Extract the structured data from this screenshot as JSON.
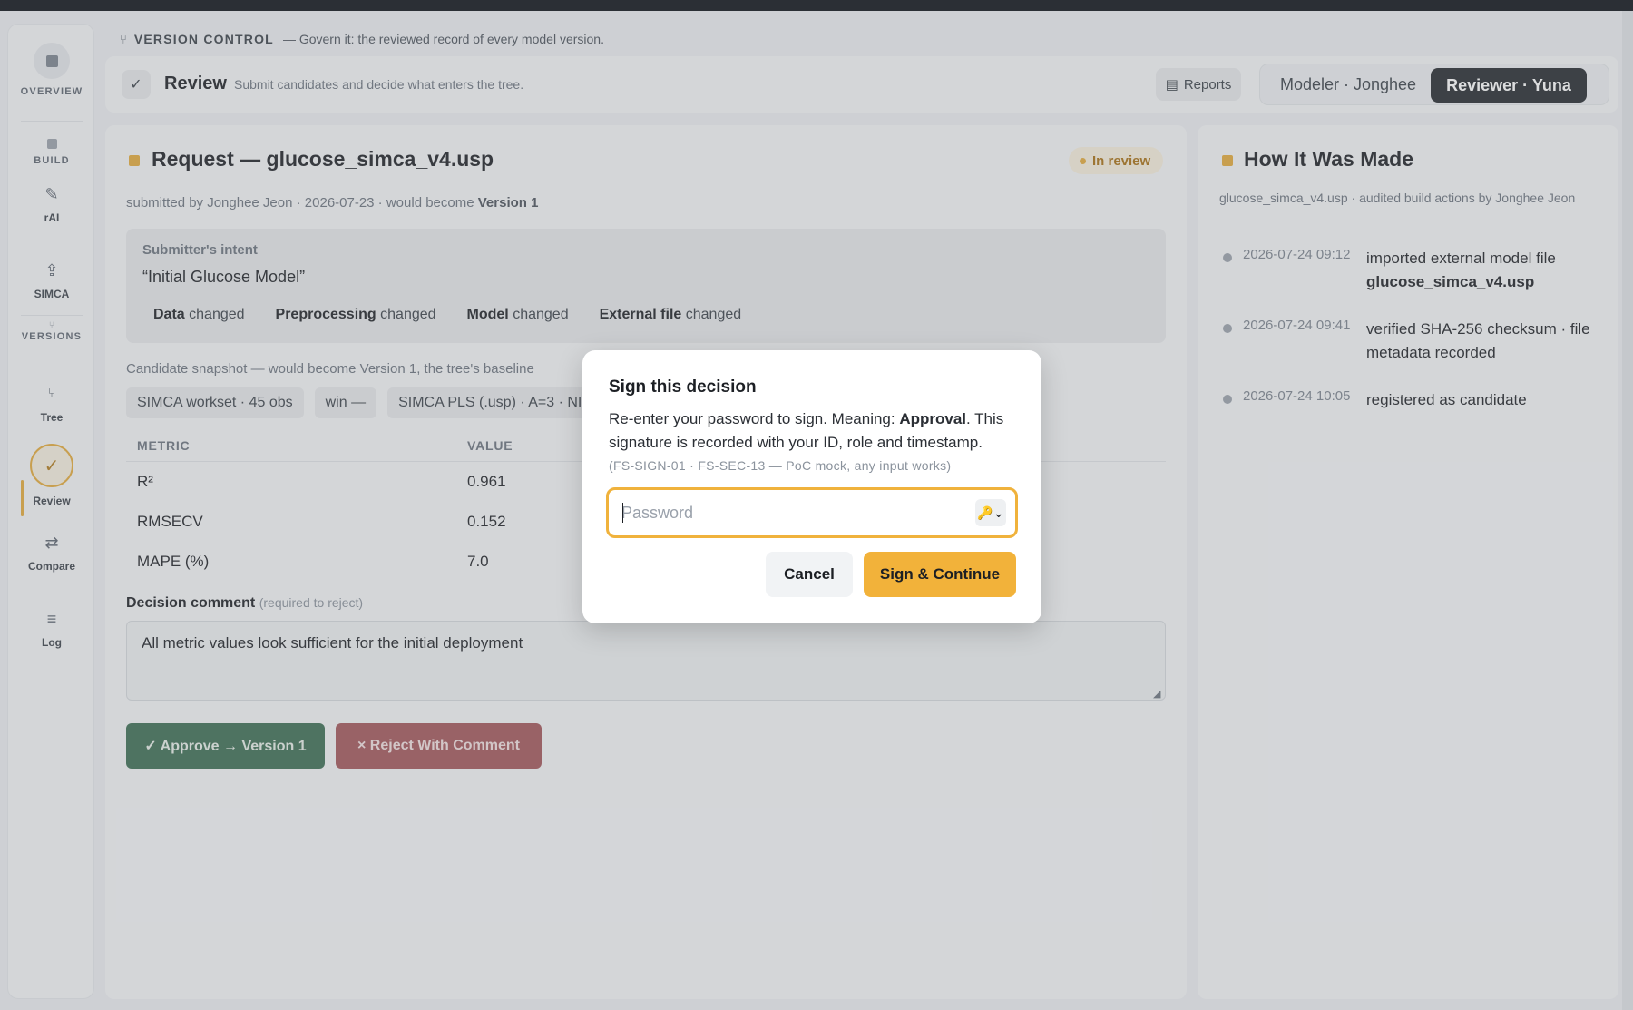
{
  "sidebar": {
    "items": [
      {
        "label": "OVERVIEW",
        "icon": "square-icon"
      },
      {
        "label": "BUILD",
        "icon": "square-icon"
      },
      {
        "label": "rAI",
        "icon": "pencil-icon"
      },
      {
        "label": "SIMCA",
        "icon": "upload-icon"
      },
      {
        "label": "VERSIONS",
        "icon": "branch-icon"
      },
      {
        "label": "Tree",
        "icon": "branch-icon"
      },
      {
        "label": "Review",
        "icon": "check-icon"
      },
      {
        "label": "Compare",
        "icon": "swap-icon"
      },
      {
        "label": "Log",
        "icon": "menu-icon"
      }
    ],
    "glyphs": {
      "pencil": "✎",
      "upload": "⇪",
      "branch": "⑂",
      "check": "✓",
      "swap": "⇄",
      "menu": "≡"
    }
  },
  "version_control": {
    "title": "VERSION CONTROL",
    "tagline": "— Govern it: the reviewed record of every model version."
  },
  "header": {
    "check_glyph": "✓",
    "title": "Review",
    "subtitle": "Submit candidates and decide what enters the tree.",
    "reports_label": "Reports",
    "reports_glyph": "▤",
    "roles": {
      "modeler": "Modeler · Jonghee",
      "reviewer": "Reviewer · Yuna"
    }
  },
  "request": {
    "title": "Request — glucose_simca_v4.usp",
    "status": "In review",
    "meta_prefix": "submitted by Jonghee Jeon · 2026-07-23 · would become ",
    "meta_version": "Version 1",
    "intent_label": "Submitter's intent",
    "intent_text": "“Initial Glucose Model”",
    "changed_word": "changed",
    "changes": [
      "Data",
      "Preprocessing",
      "Model",
      "External file"
    ],
    "snapshot_label": "Candidate snapshot — would become Version 1, the tree's baseline",
    "snapshot_chips": [
      "SIMCA workset · 45 obs",
      "win —",
      "SIMCA PLS (.usp) · A=3 · NI"
    ],
    "metrics": {
      "headers": [
        "METRIC",
        "VALUE"
      ],
      "rows": [
        {
          "metric": "R²",
          "value": "0.961"
        },
        {
          "metric": "RMSECV",
          "value": "0.152"
        },
        {
          "metric": "MAPE (%)",
          "value": "7.0"
        }
      ]
    },
    "comment_label": "Decision comment",
    "comment_hint": "(required to reject)",
    "comment_value": "All metric values look sufficient for the initial deployment",
    "approve_label": "✓ Approve → Version 1",
    "reject_label": "× Reject With Comment"
  },
  "history": {
    "title": "How It Was Made",
    "meta": "glucose_simca_v4.usp · audited build actions by Jonghee Jeon",
    "events": [
      {
        "time": "2026-07-24 09:12",
        "text": "imported external model file",
        "detail": "glucose_simca_v4.usp"
      },
      {
        "time": "2026-07-24 09:41",
        "text": "verified SHA-256 checksum · file metadata recorded",
        "detail": ""
      },
      {
        "time": "2026-07-24 10:05",
        "text": "registered as candidate",
        "detail": ""
      }
    ]
  },
  "modal": {
    "title": "Sign this decision",
    "body_prefix": "Re-enter your password to sign. Meaning: ",
    "meaning": "Approval",
    "body_suffix": ". This signature is recorded with your ID, role and timestamp.",
    "note": "(FS-SIGN-01 · FS-SEC-13 — PoC mock, any input works)",
    "password_placeholder": "Password",
    "password_value": "",
    "key_glyph": "🔑⌄",
    "cancel_label": "Cancel",
    "sign_label": "Sign & Continue"
  },
  "colors": {
    "accent": "#e3a93a",
    "primary_dark": "#23272d",
    "approve": "#3b6d52",
    "reject": "#a25559",
    "sign_button": "#f2b23a"
  }
}
